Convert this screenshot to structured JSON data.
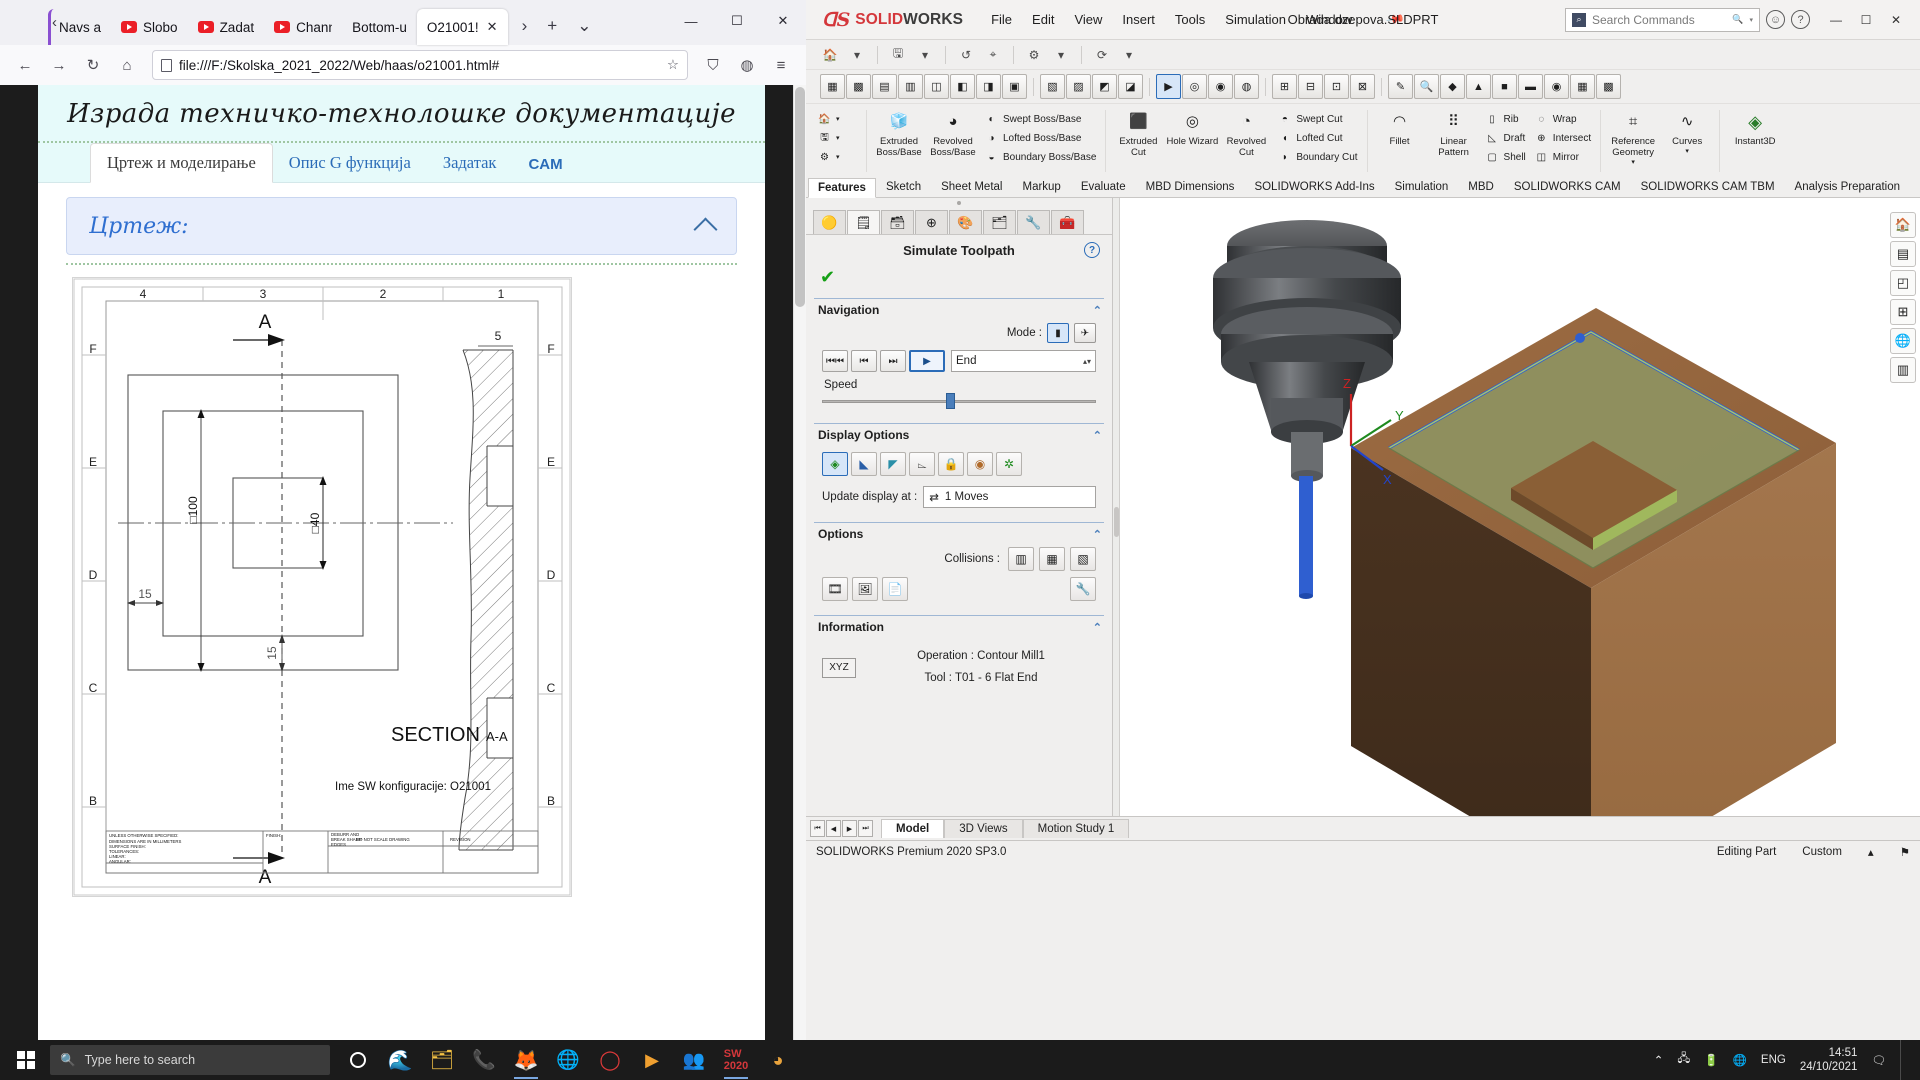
{
  "browser": {
    "tabs": [
      {
        "label": "Navs a",
        "icon": "none",
        "active": false
      },
      {
        "label": "Slobo",
        "icon": "youtube-icon",
        "active": false
      },
      {
        "label": "Zadat",
        "icon": "youtube-icon",
        "active": false
      },
      {
        "label": "Chann",
        "icon": "youtube-icon",
        "active": false
      },
      {
        "label": "Bottom-u",
        "icon": "none",
        "active": false
      },
      {
        "label": "O21001!",
        "icon": "none",
        "active": true
      }
    ],
    "tab_close_glyph": "✕",
    "scroll_prev_glyph": "‹",
    "scroll_next_glyph": "›",
    "newtab_glyph": "+",
    "listall_glyph": "⌄",
    "window_controls": {
      "minimize": "—",
      "maximize": "☐",
      "close": "✕"
    },
    "nav": {
      "back": "←",
      "forward": "→",
      "reload": "↻",
      "home": "⌂",
      "bookmark": "☆",
      "shield": "⛉",
      "account": "◍",
      "menu": "≡"
    },
    "url": "file:///F:/Skolska_2021_2022/Web/haas/o21001.html#"
  },
  "webpage": {
    "title": "Израда техничко-технолошке документације",
    "tabs": [
      {
        "label": "Цртеж и моделирање",
        "active": true
      },
      {
        "label": "Опис G функција",
        "active": false
      },
      {
        "label": "Задатак",
        "active": false
      },
      {
        "label": "CAM",
        "active": false
      }
    ],
    "accordion": {
      "title": "Цртеж:",
      "chevron": "chevron-up-icon"
    },
    "drawing": {
      "col_labels": [
        "4",
        "3",
        "2",
        "1"
      ],
      "row_labels_left": [
        "F",
        "E",
        "D",
        "C",
        "B"
      ],
      "row_labels_right": [
        "F",
        "E",
        "D",
        "C",
        "B"
      ],
      "section_marker_top": "A",
      "section_marker_bottom": "A",
      "dim_outer": "□100",
      "dim_inner": "□40",
      "dim_left": "15",
      "dim_bottom": "15",
      "detail_num": "5",
      "section_label": "SECTION",
      "section_name": "A-A",
      "config_text": "Ime SW konfiguracije: O21001",
      "titleblock": {
        "notes": [
          "UNLESS OTHERWISE SPECIFIED:",
          "DIMENSIONS ARE IN MILLIMETERS",
          "SURFACE FINISH:",
          "TOLERANCES:",
          "LINEAR:",
          "ANGULAR:"
        ],
        "cells": [
          "FINISH:",
          "DEBURR AND BREAK SHARP EDGES",
          "DO NOT SCALE DRAWING",
          "REVISION"
        ]
      }
    }
  },
  "solidworks": {
    "logo_text_red": "SOLID",
    "logo_text_dark": "WORKS",
    "menu": [
      "File",
      "Edit",
      "View",
      "Insert",
      "Tools",
      "Simulation",
      "Window"
    ],
    "pin_icon": "pin-icon",
    "document_title": "Obrada dzepova.SLDPRT",
    "search_placeholder": "Search Commands",
    "window_controls": {
      "minimize": "—",
      "maximize": "☐",
      "close": "✕"
    },
    "ribbon": {
      "groups": [
        {
          "big": [
            {
              "label": "Extruded Boss/Base",
              "icon": "extruded-boss-icon"
            },
            {
              "label": "Revolved Boss/Base",
              "icon": "revolved-boss-icon"
            }
          ],
          "small": [
            {
              "label": "Swept Boss/Base",
              "icon": "swept-boss-icon"
            },
            {
              "label": "Lofted Boss/Base",
              "icon": "lofted-boss-icon"
            },
            {
              "label": "Boundary Boss/Base",
              "icon": "boundary-boss-icon"
            }
          ]
        },
        {
          "big": [
            {
              "label": "Extruded Cut",
              "icon": "extruded-cut-icon"
            },
            {
              "label": "Hole Wizard",
              "icon": "hole-wizard-icon"
            },
            {
              "label": "Revolved Cut",
              "icon": "revolved-cut-icon"
            }
          ],
          "small": [
            {
              "label": "Swept Cut",
              "icon": "swept-cut-icon"
            },
            {
              "label": "Lofted Cut",
              "icon": "lofted-cut-icon"
            },
            {
              "label": "Boundary Cut",
              "icon": "boundary-cut-icon"
            }
          ]
        },
        {
          "big": [
            {
              "label": "Fillet",
              "icon": "fillet-icon"
            },
            {
              "label": "Linear Pattern",
              "icon": "linear-pattern-icon"
            }
          ],
          "small": [
            {
              "label": "Rib",
              "icon": "rib-icon"
            },
            {
              "label": "Draft",
              "icon": "draft-icon"
            },
            {
              "label": "Shell",
              "icon": "shell-icon"
            },
            {
              "label": "Wrap",
              "icon": "wrap-icon"
            },
            {
              "label": "Intersect",
              "icon": "intersect-icon"
            },
            {
              "label": "Mirror",
              "icon": "mirror-icon"
            }
          ]
        },
        {
          "big": [
            {
              "label": "Reference Geometry",
              "icon": "reference-geometry-icon"
            },
            {
              "label": "Curves",
              "icon": "curves-icon"
            }
          ],
          "small": []
        },
        {
          "big": [
            {
              "label": "Instant3D",
              "icon": "instant3d-icon"
            }
          ],
          "small": []
        }
      ]
    },
    "ribbon_tabs": [
      {
        "label": "Features",
        "active": true
      },
      {
        "label": "Sketch",
        "active": false
      },
      {
        "label": "Sheet Metal",
        "active": false
      },
      {
        "label": "Markup",
        "active": false
      },
      {
        "label": "Evaluate",
        "active": false
      },
      {
        "label": "MBD Dimensions",
        "active": false
      },
      {
        "label": "SOLIDWORKS Add-Ins",
        "active": false
      },
      {
        "label": "Simulation",
        "active": false
      },
      {
        "label": "MBD",
        "active": false
      },
      {
        "label": "SOLIDWORKS CAM",
        "active": false
      },
      {
        "label": "SOLIDWORKS CAM TBM",
        "active": false
      },
      {
        "label": "Analysis Preparation",
        "active": false
      }
    ],
    "panel": {
      "tabs": [
        {
          "icon": "feature-tree-icon",
          "active": true
        },
        {
          "icon": "property-manager-icon",
          "active": false
        },
        {
          "icon": "configuration-manager-icon",
          "active": false
        },
        {
          "icon": "dimxpert-icon",
          "active": false
        },
        {
          "icon": "appearances-icon",
          "active": false
        },
        {
          "icon": "cam-feature-tree-icon",
          "active": false
        },
        {
          "icon": "cam-operation-tree-icon",
          "active": false
        },
        {
          "icon": "cam-tools-tree-icon",
          "active": false
        }
      ],
      "title": "Simulate Toolpath",
      "help_glyph": "?",
      "confirm_icon": "green-check-icon",
      "navigation": {
        "header": "Navigation",
        "mode_label": "Mode :",
        "mode_buttons": [
          "tool-mode-icon",
          "fast-mode-icon"
        ],
        "buttons": [
          "rewind-icon",
          "step-back-icon",
          "step-forward-icon",
          "play-icon"
        ],
        "end_value": "End",
        "speed_label": "Speed"
      },
      "display_options": {
        "header": "Display Options",
        "icons": [
          "shaded-display-icon",
          "tool-display-icon",
          "holder-display-icon",
          "fixture-display-icon",
          "stock-display-icon",
          "toolpath-display-icon",
          "collision-display-icon"
        ]
      },
      "options": {
        "header": "Options",
        "collisions_label": "Collisions :",
        "collision_icons": [
          "collision-1-icon",
          "collision-2-icon",
          "collision-3-icon"
        ],
        "output_icons": [
          "save-avi-icon",
          "save-image-icon",
          "save-jpg-icon"
        ],
        "wrench_icon": "wrench-icon"
      },
      "information": {
        "header": "Information",
        "xyz_label": "XYZ",
        "operation_label": "Operation :",
        "operation_value": "Contour Mill1",
        "tool_label": "Tool :",
        "tool_value": "T01 - 6 Flat End"
      }
    },
    "viewport": {
      "axes": {
        "x": "X",
        "y": "Y",
        "z": "Z"
      },
      "right_icons": [
        "view-home-icon",
        "view-display-icon",
        "view-section-icon",
        "view-appearance-icon",
        "view-scene-icon",
        "view-hide-icon"
      ]
    },
    "bottom_tabs": [
      {
        "label": "Model",
        "active": true
      },
      {
        "label": "3D Views",
        "active": false
      },
      {
        "label": "Motion Study 1",
        "active": false
      }
    ],
    "status_bar": {
      "left": "SOLIDWORKS Premium 2020 SP3.0",
      "editing": "Editing Part",
      "units": "Custom",
      "units_caret": "▴",
      "flag_icon": "flag-icon"
    }
  },
  "taskbar": {
    "start_icon": "windows-start-icon",
    "search_placeholder": "Type here to search",
    "search_icon": "search-icon",
    "items": [
      {
        "icon": "cortana-icon",
        "active": false
      },
      {
        "icon": "edge-icon",
        "active": false
      },
      {
        "icon": "file-explorer-icon",
        "active": false
      },
      {
        "icon": "viber-icon",
        "active": false
      },
      {
        "icon": "firefox-icon",
        "active": true
      },
      {
        "icon": "chrome-icon",
        "active": false
      },
      {
        "icon": "opera-icon",
        "active": false
      },
      {
        "icon": "media-player-icon",
        "active": false
      },
      {
        "icon": "teams-icon",
        "active": false
      },
      {
        "icon": "solidworks-icon",
        "active": true
      },
      {
        "icon": "app-icon",
        "active": false
      }
    ],
    "tray": {
      "chevron": "⌃",
      "icons": [
        "network-icon",
        "battery-icon",
        "language-globe-icon"
      ],
      "language": "ENG",
      "time": "14:51",
      "date": "24/10/2021",
      "action_center": "action-center-icon"
    }
  }
}
